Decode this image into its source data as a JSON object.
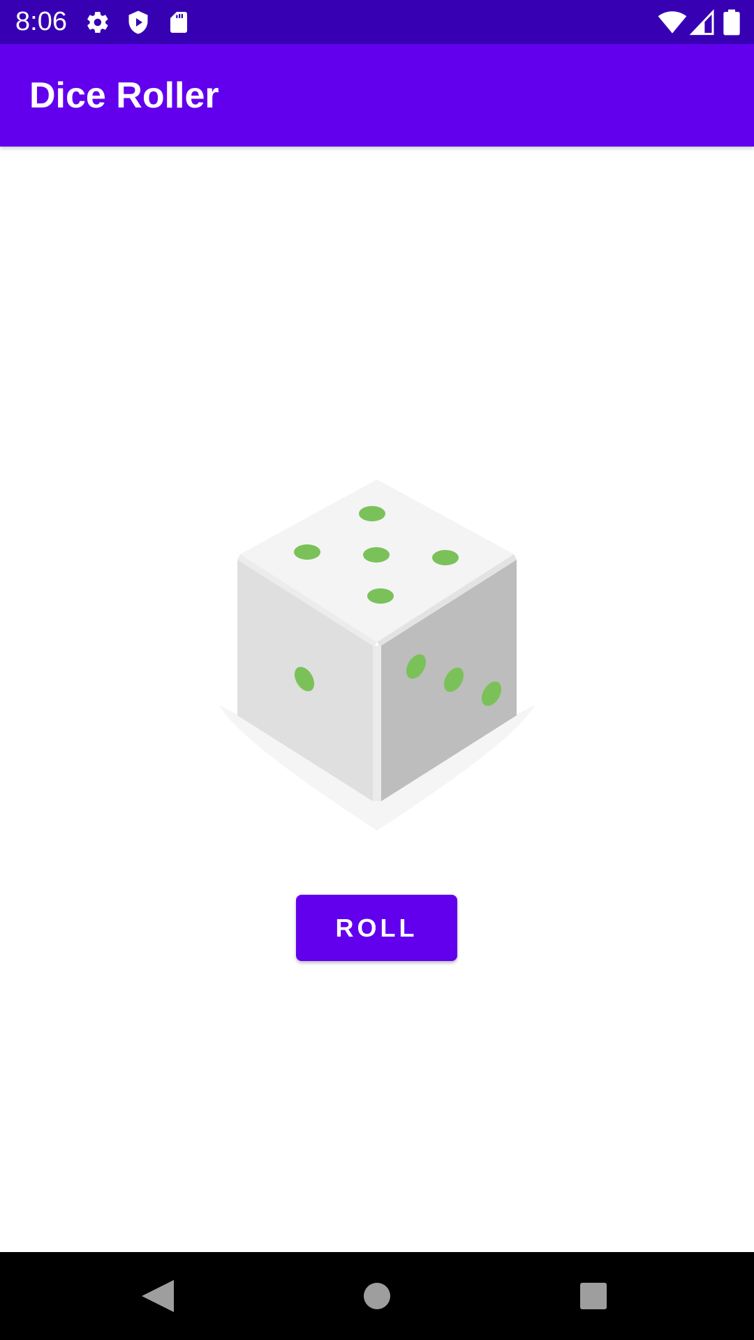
{
  "status_bar": {
    "time": "8:06",
    "background_color": "#3700b3",
    "left_icons": [
      "gear-icon",
      "shield-play-icon",
      "sd-card-icon"
    ],
    "right_icons": [
      "wifi-icon",
      "cell-signal-icon",
      "battery-icon"
    ]
  },
  "app_bar": {
    "title": "Dice Roller",
    "background_color": "#6200ee"
  },
  "dice": {
    "icon": "dice-icon",
    "top_face_pips": 5,
    "left_face_pips": 1,
    "right_face_pips": 3,
    "pip_color": "#7bc15a"
  },
  "roll_button": {
    "label": "ROLL",
    "background_color": "#6200ee"
  },
  "nav_bar": {
    "buttons": [
      "back-icon",
      "home-icon",
      "recents-icon"
    ]
  }
}
